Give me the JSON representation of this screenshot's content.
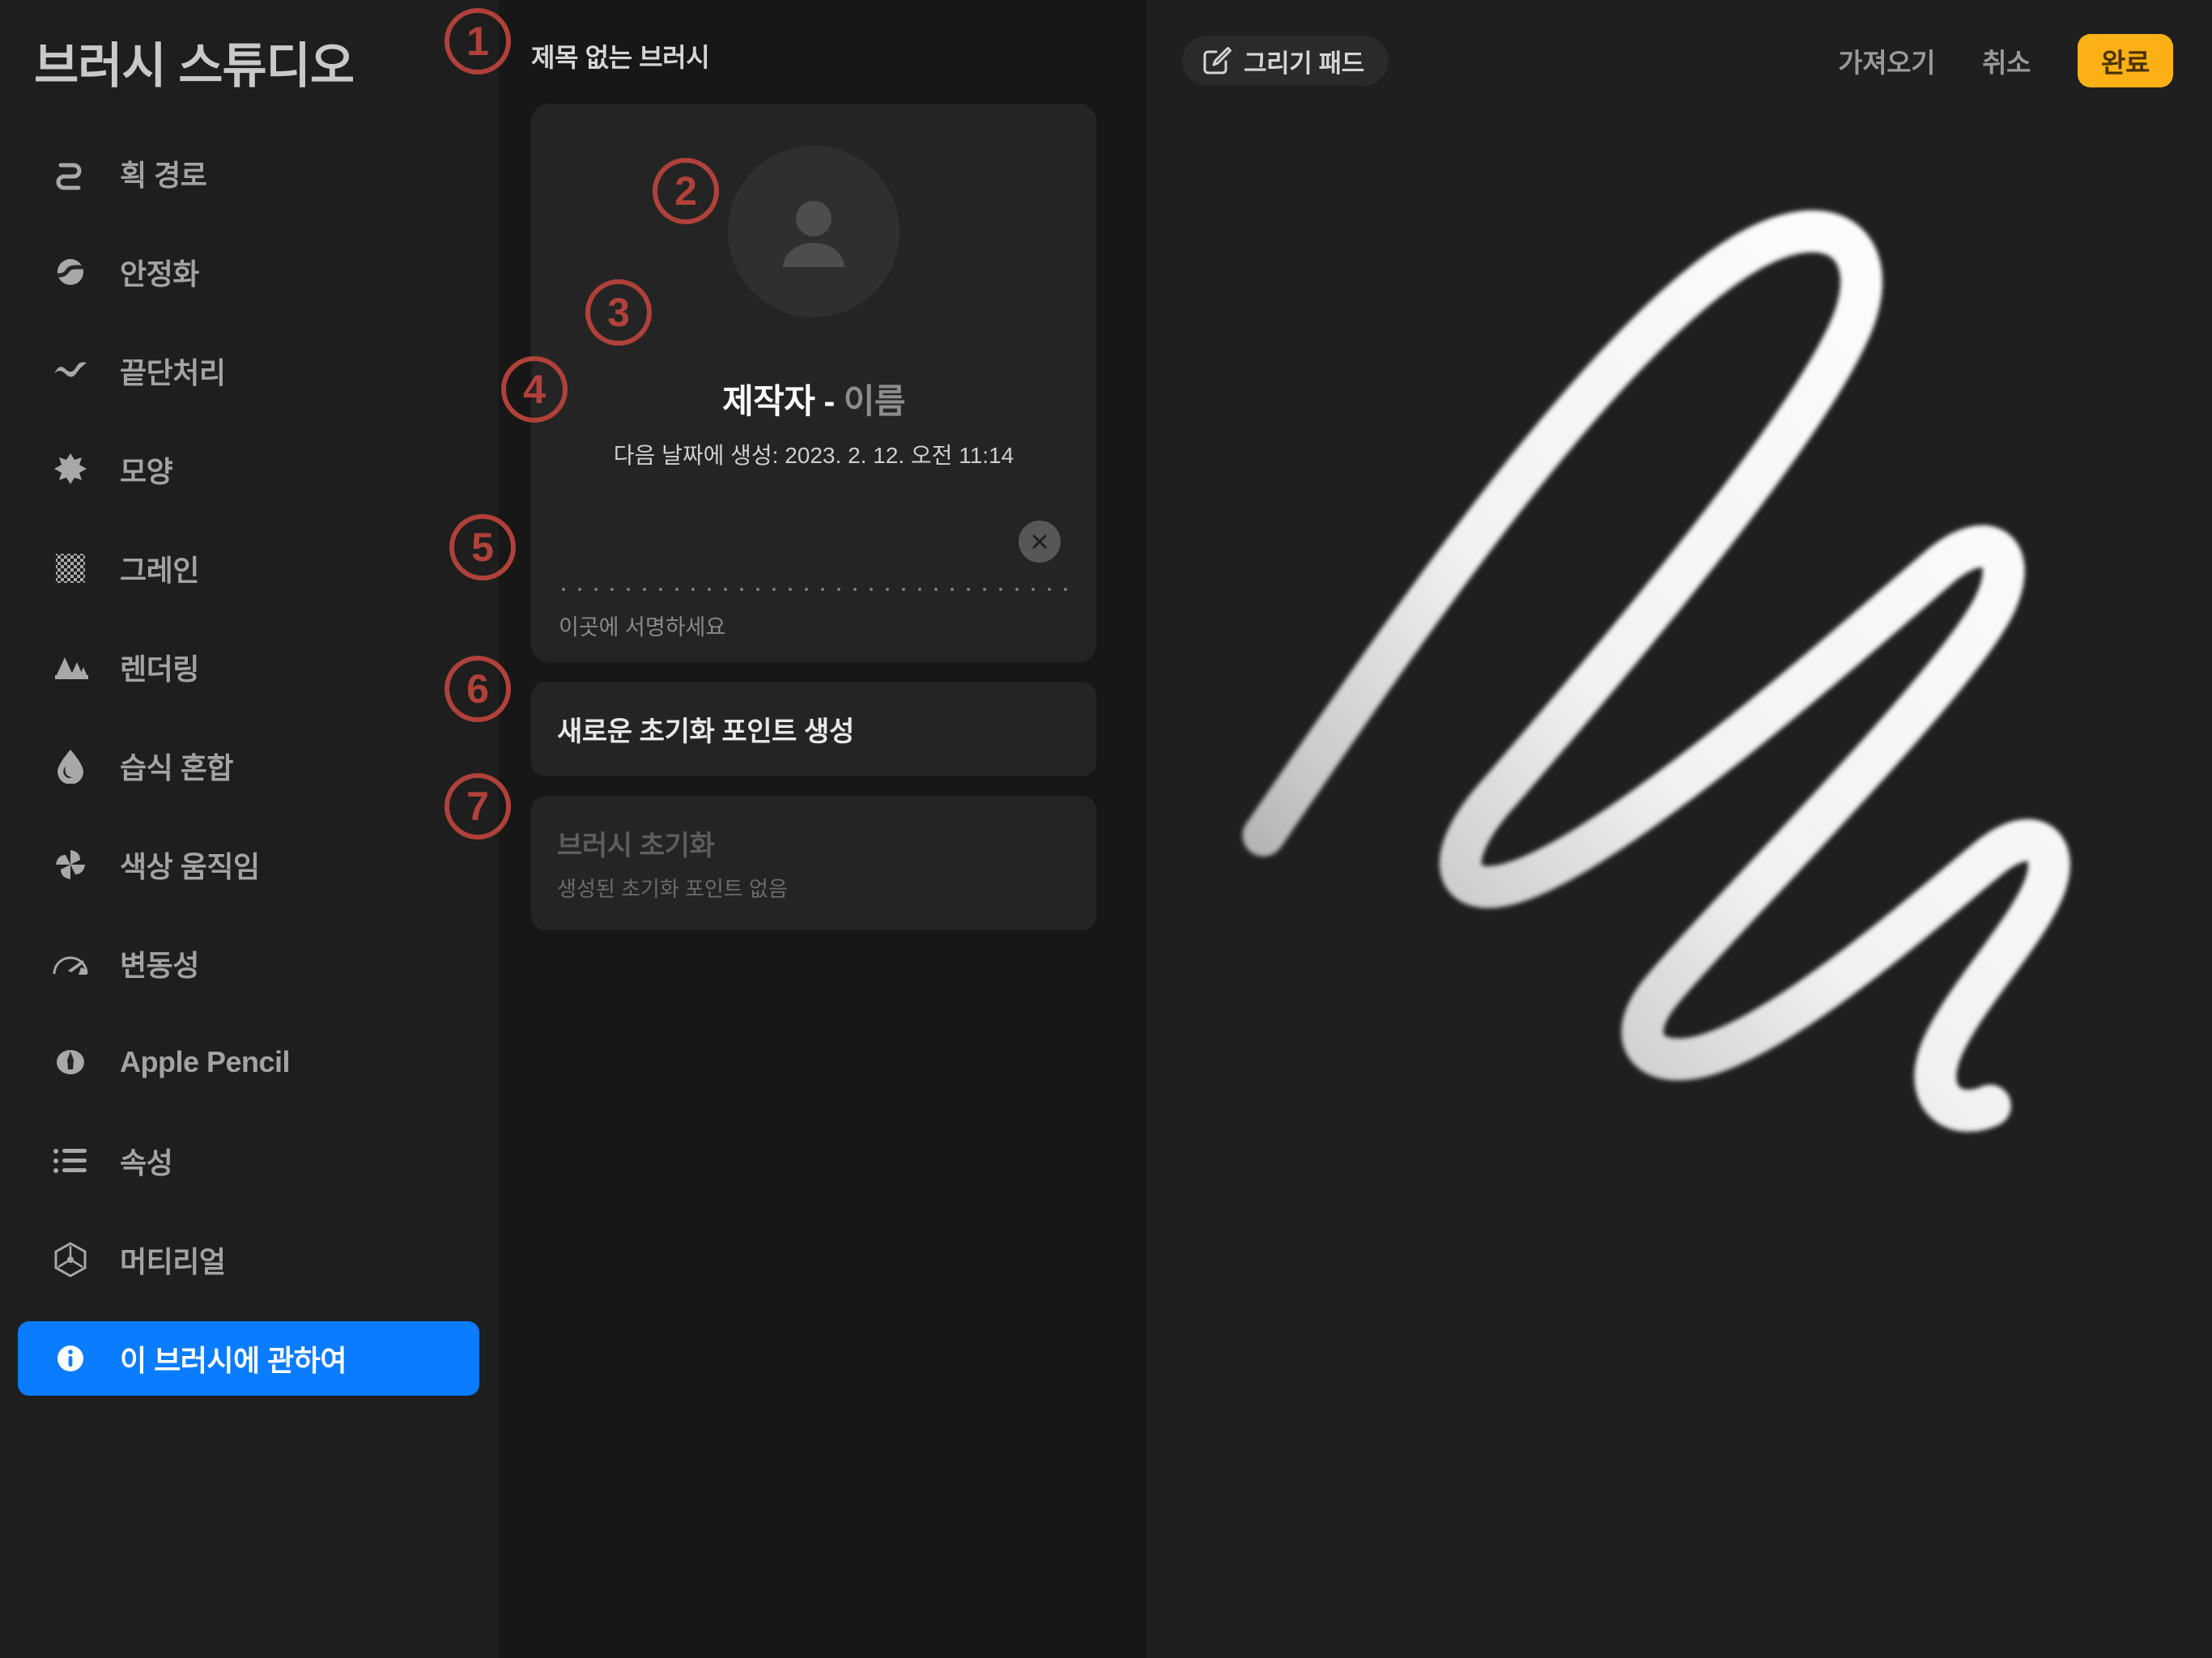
{
  "sidebar": {
    "title": "브러시 스튜디오",
    "items": [
      {
        "label": "획 경로",
        "icon": "stroke-path-icon",
        "selected": false
      },
      {
        "label": "안정화",
        "icon": "stabilization-icon",
        "selected": false
      },
      {
        "label": "끝단처리",
        "icon": "taper-icon",
        "selected": false
      },
      {
        "label": "모양",
        "icon": "shape-icon",
        "selected": false
      },
      {
        "label": "그레인",
        "icon": "grain-icon",
        "selected": false
      },
      {
        "label": "렌더링",
        "icon": "rendering-icon",
        "selected": false
      },
      {
        "label": "습식 혼합",
        "icon": "wet-mix-icon",
        "selected": false
      },
      {
        "label": "색상 움직임",
        "icon": "color-dynamics-icon",
        "selected": false
      },
      {
        "label": "변동성",
        "icon": "dynamics-icon",
        "selected": false
      },
      {
        "label": "Apple Pencil",
        "icon": "apple-pencil-icon",
        "selected": false
      },
      {
        "label": "속성",
        "icon": "properties-icon",
        "selected": false
      },
      {
        "label": "머티리얼",
        "icon": "materials-icon",
        "selected": false
      },
      {
        "label": "이 브러시에 관하여",
        "icon": "info-icon",
        "selected": true
      }
    ]
  },
  "middle": {
    "brush_name": "제목 없는 브러시",
    "author_card": {
      "avatar_icon": "person-avatar-icon",
      "author_label": "제작자",
      "separator": "-",
      "author_name": "이름",
      "created_text": "다음 날짜에 생성: 2023. 2. 12. 오전 11:14",
      "signature_placeholder": "이곳에 서명하세요",
      "clear_icon": "close-circle-icon"
    },
    "create_reset_point_button": "새로운 초기화 포인트 생성",
    "reset_brush_button": {
      "label": "브러시 초기화",
      "sublabel": "생성된 초기화 포인트 없음"
    }
  },
  "toolbar": {
    "drawing_pad_label": "그리기 패드",
    "drawing_pad_icon": "pencil-square-icon",
    "import_label": "가져오기",
    "cancel_label": "취소",
    "done_label": "완료"
  },
  "annotations": [
    {
      "number": "①",
      "digit": "1"
    },
    {
      "number": "②",
      "digit": "2"
    },
    {
      "number": "③",
      "digit": "3"
    },
    {
      "number": "④",
      "digit": "4"
    },
    {
      "number": "⑤",
      "digit": "5"
    },
    {
      "number": "⑥",
      "digit": "6"
    },
    {
      "number": "⑦",
      "digit": "7"
    }
  ],
  "colors": {
    "accent_selected": "#0a7cff",
    "done_button": "#fbb016",
    "annotation": "#b0413a",
    "sidebar_bg": "#1e1e1e",
    "mid_panel_bg": "#171717",
    "canvas_bg": "#1f1f1f",
    "card_bg": "#242424"
  }
}
